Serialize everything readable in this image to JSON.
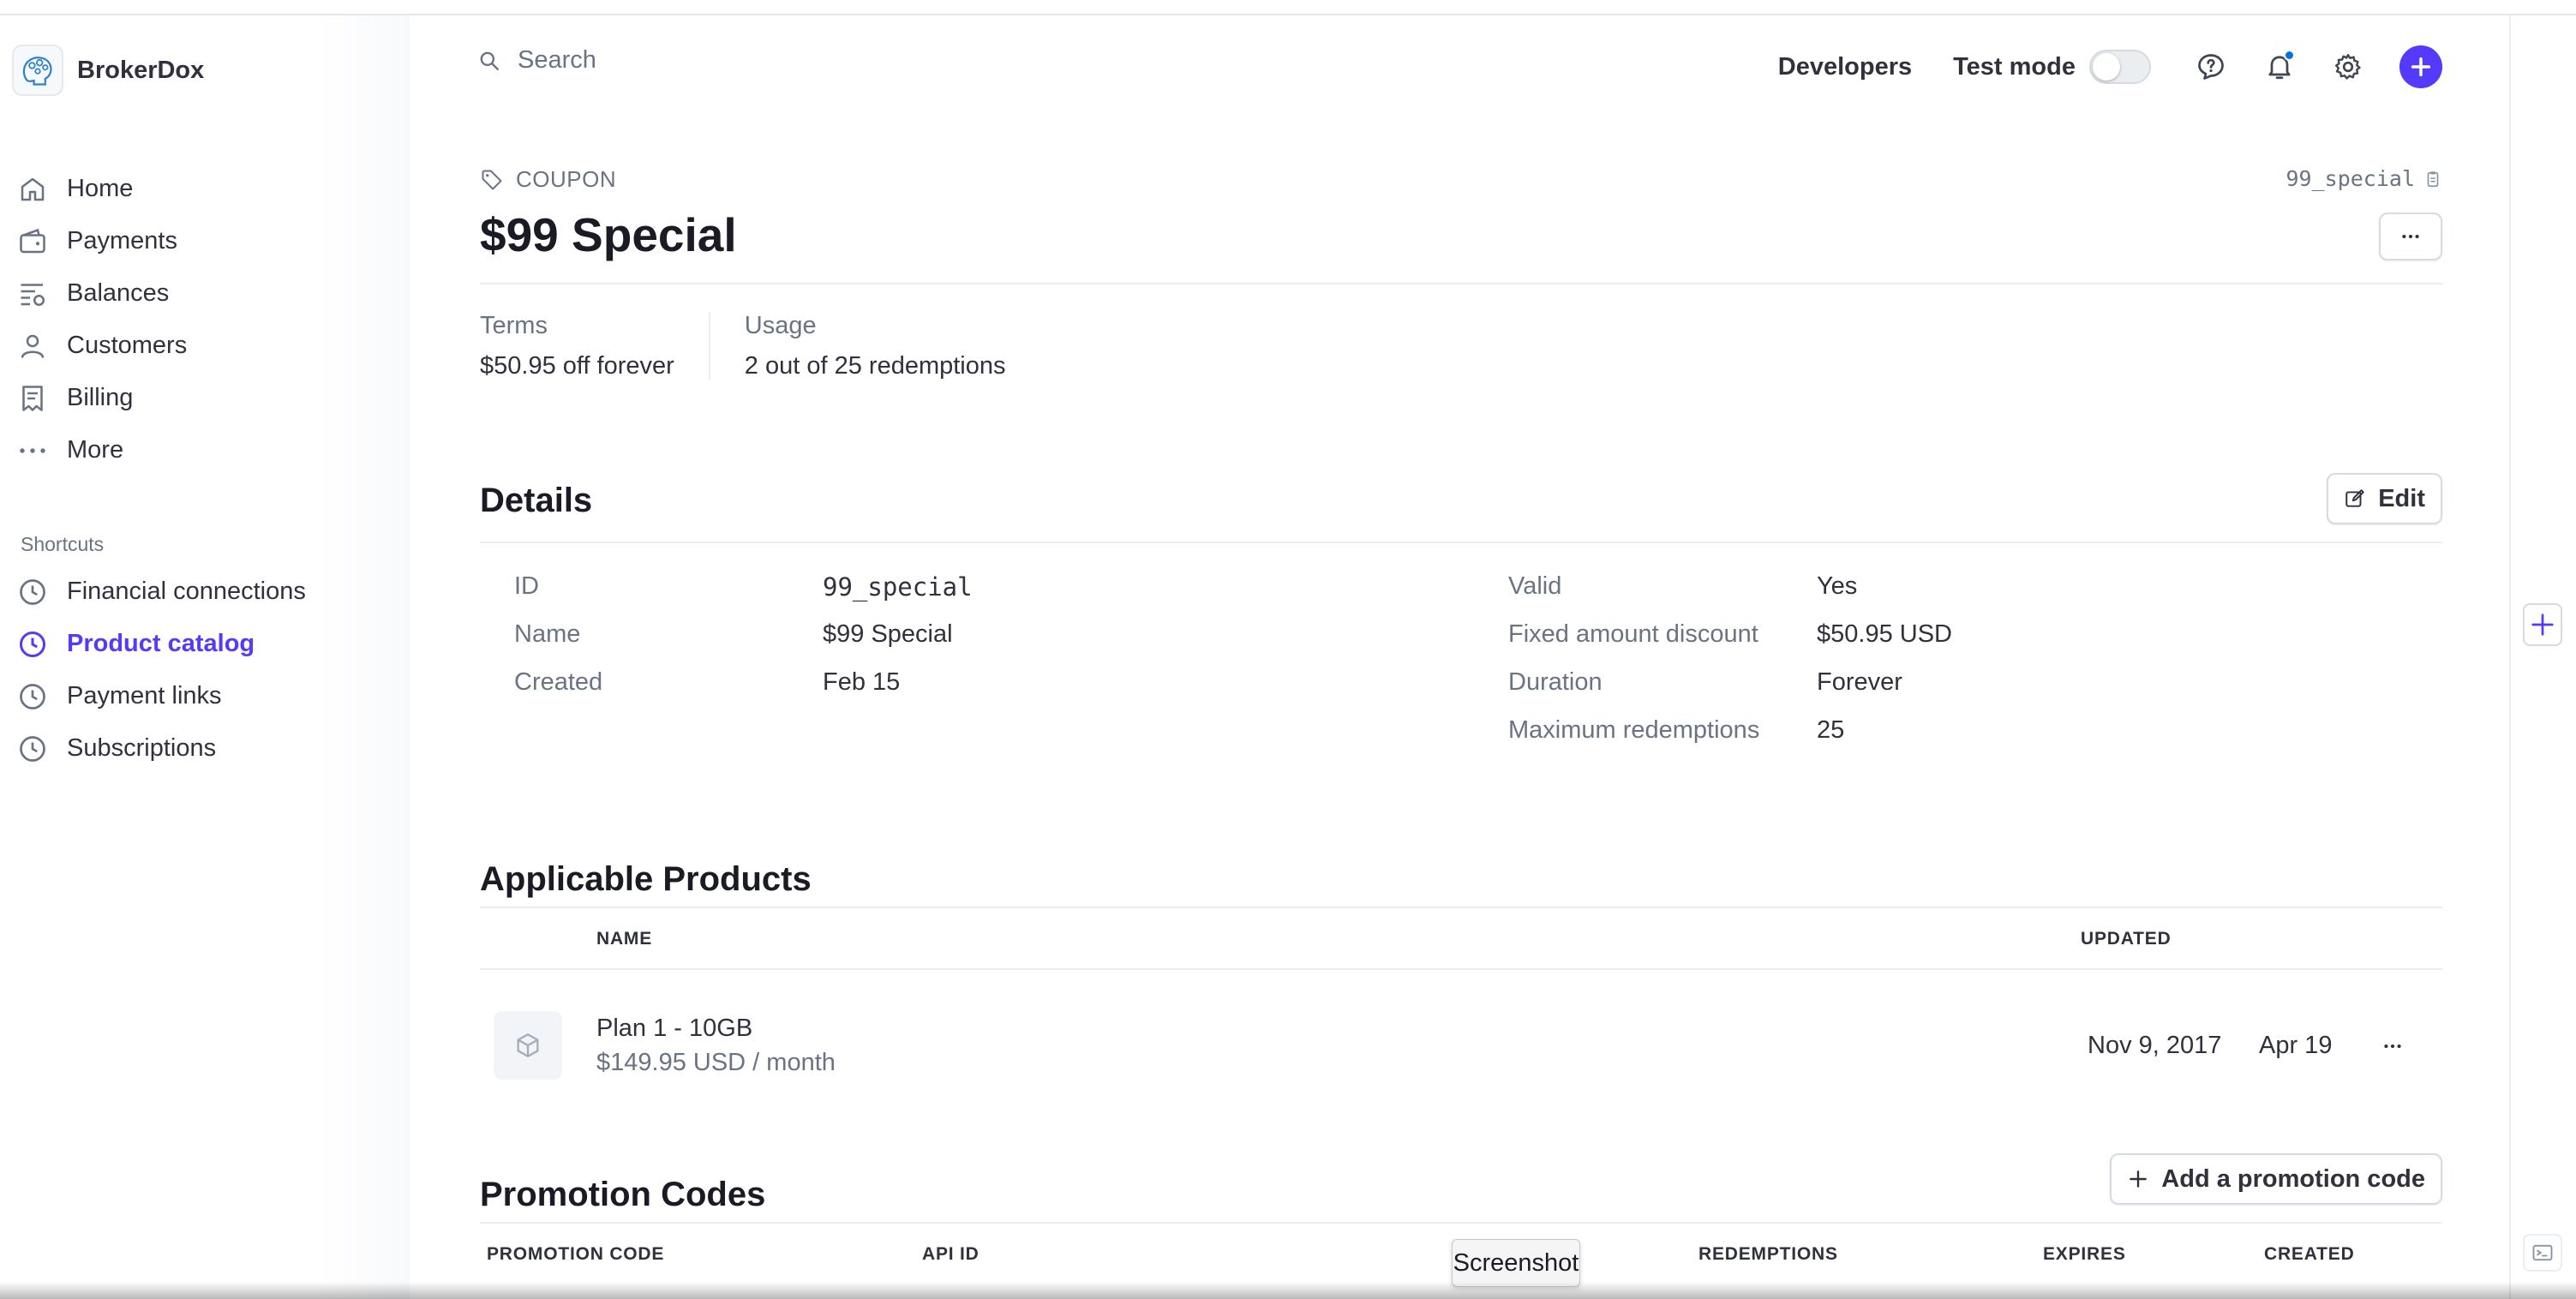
{
  "app": {
    "name": "BrokerDox"
  },
  "sidebar": {
    "items": [
      {
        "label": "Home",
        "icon": "home-icon"
      },
      {
        "label": "Payments",
        "icon": "wallet-icon"
      },
      {
        "label": "Balances",
        "icon": "balances-icon"
      },
      {
        "label": "Customers",
        "icon": "person-icon"
      },
      {
        "label": "Billing",
        "icon": "receipt-icon"
      },
      {
        "label": "More",
        "icon": "ellipsis-icon"
      }
    ],
    "shortcuts_label": "Shortcuts",
    "shortcuts": [
      {
        "label": "Financial connections",
        "icon": "clock-icon",
        "active": false
      },
      {
        "label": "Product catalog",
        "icon": "clock-icon",
        "active": true
      },
      {
        "label": "Payment links",
        "icon": "clock-icon",
        "active": false
      },
      {
        "label": "Subscriptions",
        "icon": "clock-icon",
        "active": false
      }
    ]
  },
  "header": {
    "search_label": "Search",
    "developers_label": "Developers",
    "test_mode_label": "Test mode",
    "test_mode_on": false,
    "accent_color": "#533afd"
  },
  "coupon": {
    "kicker": "COUPON",
    "title": "$99 Special",
    "id_chip": "99_special",
    "terms_label": "Terms",
    "terms_value": "$50.95 off forever",
    "usage_label": "Usage",
    "usage_value": "2 out of 25 redemptions"
  },
  "details": {
    "title": "Details",
    "edit_label": "Edit",
    "left": [
      {
        "label": "ID",
        "value": "99_special"
      },
      {
        "label": "Name",
        "value": "$99 Special"
      },
      {
        "label": "Created",
        "value": "Feb 15"
      }
    ],
    "right": [
      {
        "label": "Valid",
        "value": "Yes"
      },
      {
        "label": "Fixed amount discount",
        "value": "$50.95 USD"
      },
      {
        "label": "Duration",
        "value": "Forever"
      },
      {
        "label": "Maximum redemptions",
        "value": "25"
      }
    ]
  },
  "products": {
    "title": "Applicable Products",
    "columns": {
      "name": "NAME",
      "updated": "UPDATED"
    },
    "rows": [
      {
        "name": "Plan 1 - 10GB",
        "price": "$149.95 USD / month",
        "date1": "Nov 9, 2017",
        "date2": "Apr 19"
      }
    ]
  },
  "promotion_codes": {
    "title": "Promotion Codes",
    "add_label": "Add a promotion code",
    "columns": [
      "PROMOTION CODE",
      "API ID",
      "REDEMPTIONS",
      "EXPIRES",
      "CREATED"
    ]
  },
  "tooltip": {
    "label": "Screenshot"
  }
}
